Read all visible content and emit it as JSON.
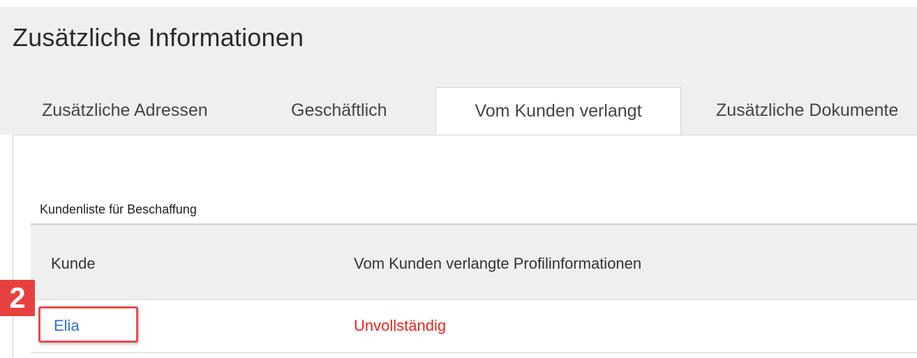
{
  "header": {
    "title": "Zusätzliche Informationen"
  },
  "tabs": [
    {
      "label": "Zusätzliche Adressen",
      "active": false
    },
    {
      "label": "Geschäftlich",
      "active": false
    },
    {
      "label": "Vom Kunden verlangt",
      "active": true
    },
    {
      "label": "Zusätzliche Dokumente",
      "active": false
    }
  ],
  "section": {
    "title": "Kundenliste für Beschaffung"
  },
  "table": {
    "columns": [
      "Kunde",
      "Vom Kunden verlangte Profilinformationen"
    ],
    "rows": [
      {
        "customer": "Elia",
        "status": "Unvollständig"
      }
    ]
  },
  "annotation": {
    "step_number": "2"
  },
  "colors": {
    "link": "#2f6fd6",
    "status_incomplete": "#e8261d",
    "callout": "#e8403f",
    "panel_background": "#efeff0"
  }
}
